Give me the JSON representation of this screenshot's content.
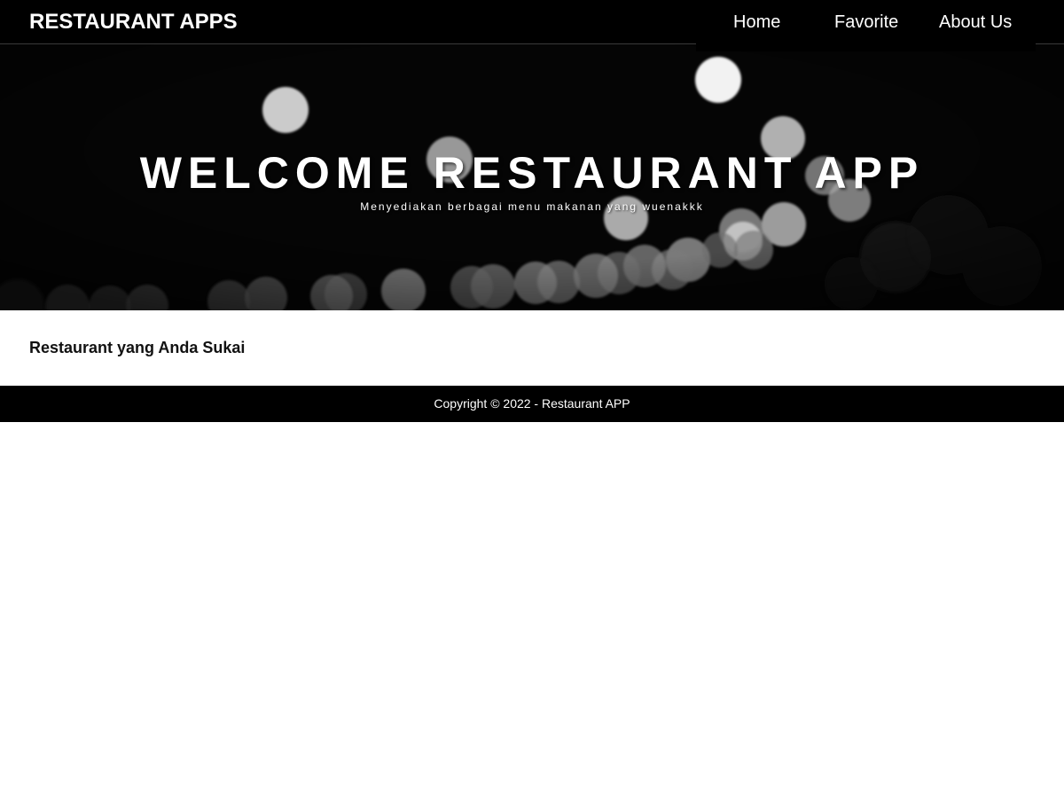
{
  "header": {
    "brand": "RESTAURANT APPS",
    "nav": [
      {
        "label": "Home"
      },
      {
        "label": "Favorite"
      },
      {
        "label": "About Us"
      }
    ]
  },
  "hero": {
    "title": "WELCOME RESTAURANT APP",
    "subtitle": "Menyediakan berbagai menu makanan yang wuenakkk",
    "image": "bokeh-lights-background"
  },
  "main": {
    "section_title": "Restaurant yang Anda Sukai"
  },
  "footer": {
    "copyright": "Copyright © 2022 - Restaurant APP"
  },
  "colors": {
    "bar_background": "#000000",
    "text_on_dark": "#ffffff",
    "page_background": "#ffffff"
  }
}
